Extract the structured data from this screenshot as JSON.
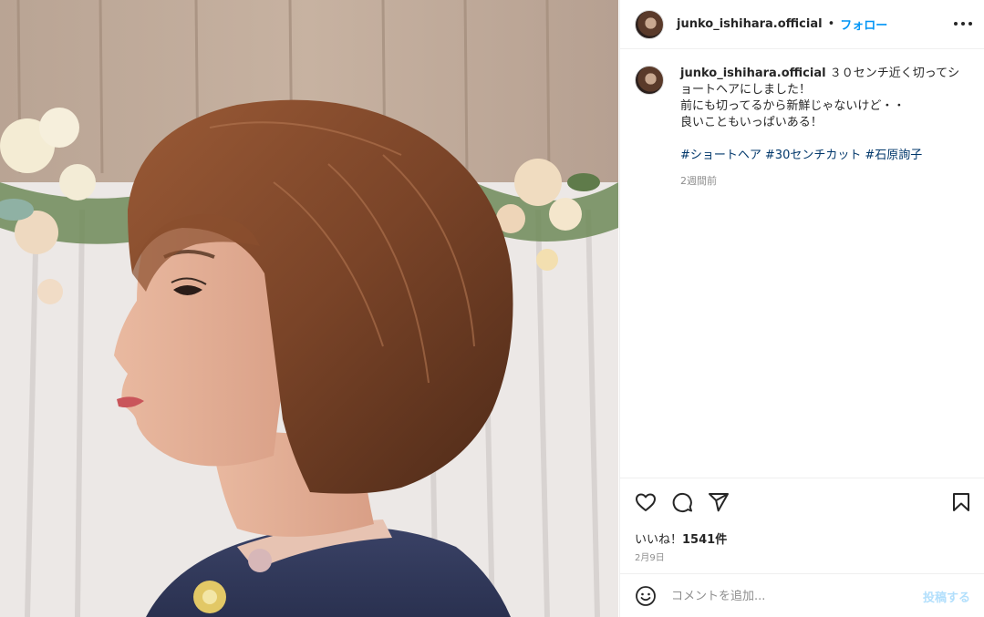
{
  "post": {
    "username": "junko_ishihara.official",
    "separator": "•",
    "follow_label": "フォロー",
    "caption_lines": [
      "３０センチ近く切ってシ",
      "ョートヘアにしました！",
      "前にも切ってるから新鮮じゃないけど・・",
      "良いこともいっぱいある！"
    ],
    "hashtags": [
      "#ショートヘア",
      "#30センチカット",
      "#石原詢子"
    ],
    "time_ago": "2週間前",
    "likes_prefix": "いいね！",
    "likes_count": "1541件",
    "date": "2月9日",
    "comment_placeholder": "コメントを追加...",
    "post_button_label": "投稿する"
  },
  "icons": {
    "header_more": "more-icon",
    "like": "heart-icon",
    "comment": "comment-icon",
    "share": "share-icon",
    "save": "bookmark-icon",
    "emoji": "emoji-icon"
  },
  "colors": {
    "link_blue": "#0095f6",
    "hashtag": "#00376b",
    "secondary_text": "#8e8e8e",
    "border": "#efefef"
  }
}
